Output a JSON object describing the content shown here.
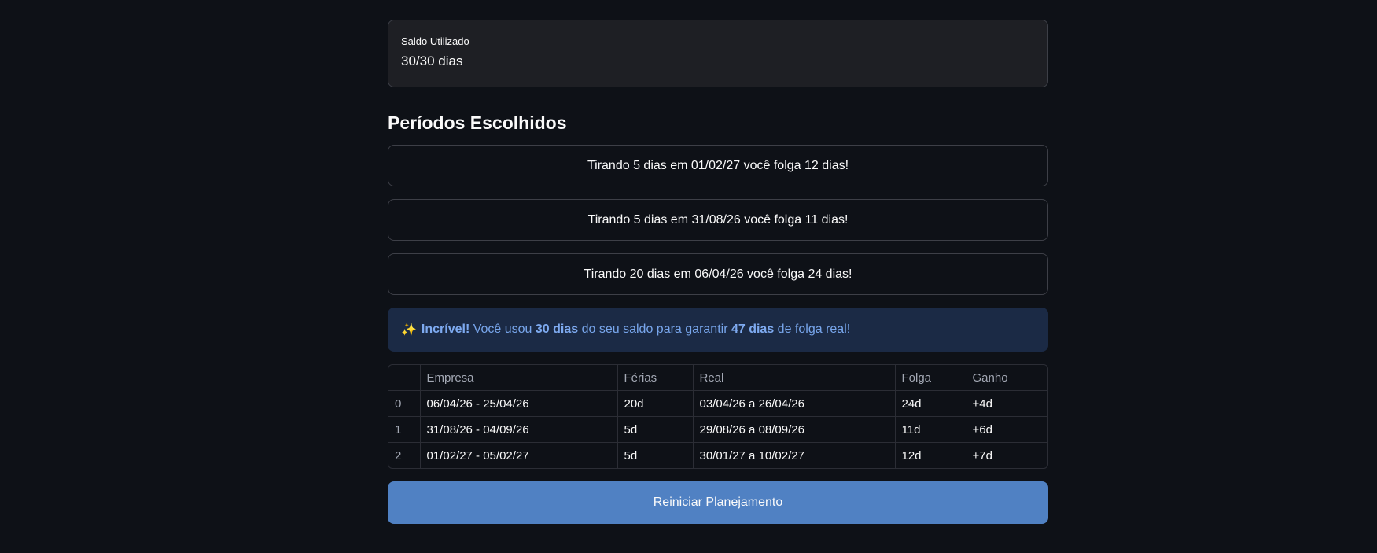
{
  "metric": {
    "label": "Saldo Utilizado",
    "value": "30/30 dias"
  },
  "section_title": "Períodos Escolhidos",
  "periods": [
    "Tirando 5 dias em 01/02/27 você folga 12 dias!",
    "Tirando 5 dias em 31/08/26 você folga 11 dias!",
    "Tirando 20 dias em 06/04/26 você folga 24 dias!"
  ],
  "info": {
    "emoji": "✨",
    "bold1": "Incrível!",
    "text1": " Você usou ",
    "bold2": "30 dias",
    "text2": " do seu saldo para garantir ",
    "bold3": "47 dias",
    "text3": " de folga real!"
  },
  "table": {
    "headers": [
      "",
      "Empresa",
      "Férias",
      "Real",
      "Folga",
      "Ganho"
    ],
    "rows": [
      [
        "0",
        "06/04/26 - 25/04/26",
        "20d",
        "03/04/26 a 26/04/26",
        "24d",
        "+4d"
      ],
      [
        "1",
        "31/08/26 - 04/09/26",
        "5d",
        "29/08/26 a 08/09/26",
        "11d",
        "+6d"
      ],
      [
        "2",
        "01/02/27 - 05/02/27",
        "5d",
        "30/01/27 a 10/02/27",
        "12d",
        "+7d"
      ]
    ]
  },
  "reset_button": "Reiniciar Planejamento"
}
